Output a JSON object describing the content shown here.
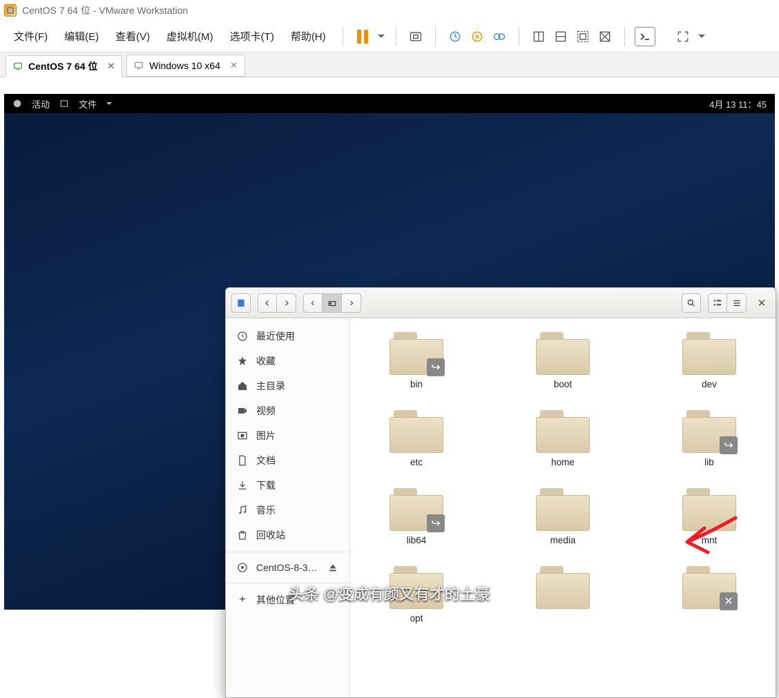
{
  "window": {
    "title": "CentOS 7 64 位 - VMware Workstation"
  },
  "menus": {
    "file": "文件(F)",
    "edit": "编辑(E)",
    "view": "查看(V)",
    "vm": "虚拟机(M)",
    "tabs": "选项卡(T)",
    "help": "帮助(H)"
  },
  "vmtabs": [
    {
      "label": "CentOS 7 64 位",
      "active": true
    },
    {
      "label": "Windows 10 x64",
      "active": false
    }
  ],
  "gnome": {
    "activities": "活动",
    "app": "文件",
    "datetime": "4月 13  11：45"
  },
  "nautilus": {
    "sidebar": {
      "recent": "最近使用",
      "starred": "收藏",
      "home": "主目录",
      "videos": "视频",
      "pictures": "图片",
      "documents": "文档",
      "downloads": "下载",
      "music": "音乐",
      "trash": "回收站",
      "disk": "CentOS-8-3…",
      "other": "其他位置"
    },
    "folders": [
      {
        "name": "bin",
        "badge": "link"
      },
      {
        "name": "boot",
        "badge": null
      },
      {
        "name": "dev",
        "badge": null
      },
      {
        "name": "etc",
        "badge": null
      },
      {
        "name": "home",
        "badge": null
      },
      {
        "name": "lib",
        "badge": "link"
      },
      {
        "name": "lib64",
        "badge": "link"
      },
      {
        "name": "media",
        "badge": null
      },
      {
        "name": "mnt",
        "badge": null
      },
      {
        "name": "opt",
        "badge": null
      },
      {
        "name": "",
        "badge": null
      },
      {
        "name": "",
        "badge": "x"
      }
    ]
  },
  "watermark": "头条 @变成有颜又有才的土豪"
}
